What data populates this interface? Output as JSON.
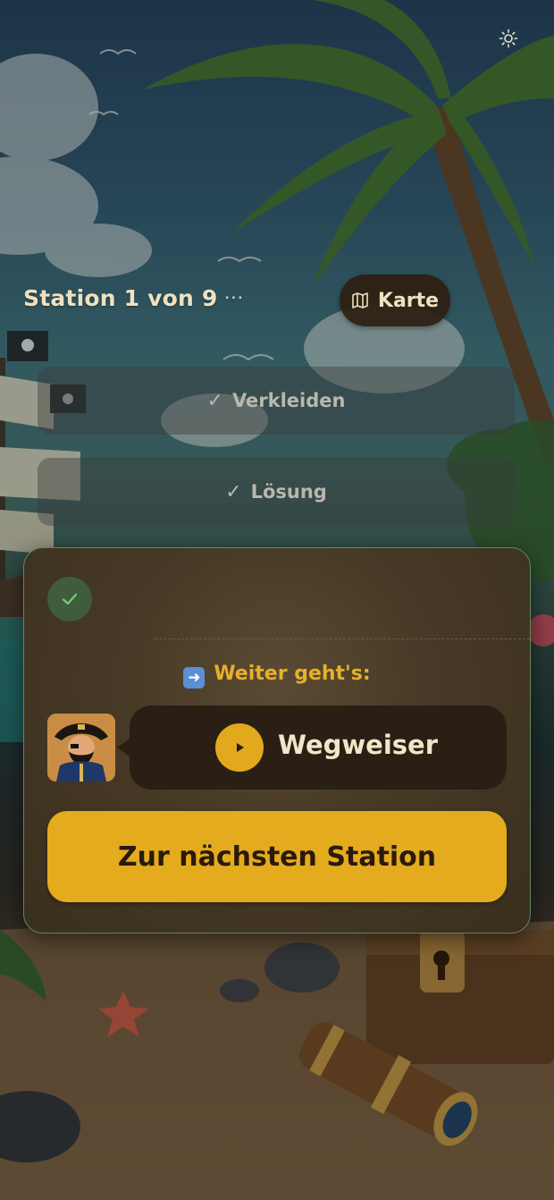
{
  "header": {
    "theme_icon": "sun-icon"
  },
  "station": {
    "title": "Station 1 von 9",
    "more_label": "···",
    "map_label": "Karte",
    "map_icon": "map-icon"
  },
  "steps": [
    {
      "label": "Verkleiden",
      "done": true
    },
    {
      "label": "Lösung",
      "done": true
    }
  ],
  "card": {
    "status_icon": "check-icon",
    "next_label": "Weiter geht's:",
    "next_icon": "arrow-right-icon",
    "avatar": "pirate-avatar",
    "audio_label": "Wegweiser",
    "audio_icon": "play-icon",
    "cta_label": "Zur nächsten Station"
  },
  "colors": {
    "accent": "#E3AB1D",
    "card_border": "#5F8A5E",
    "text_light": "#EFE1BF"
  }
}
